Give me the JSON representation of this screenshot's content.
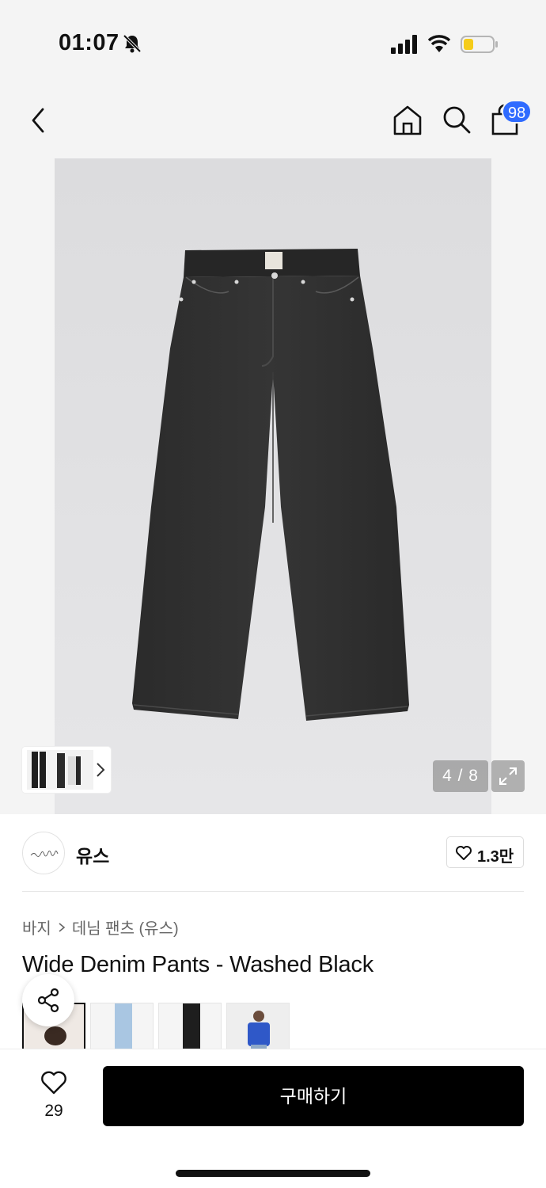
{
  "status_bar": {
    "time": "01:07"
  },
  "header": {
    "cart_badge": "98"
  },
  "gallery": {
    "page_indicator": "4 / 8"
  },
  "brand": {
    "name": "유스",
    "like_count": "1.3만"
  },
  "breadcrumb": {
    "category": "바지",
    "subcategory": "데님 팬츠 (유스)"
  },
  "product": {
    "title": "Wide Denim Pants - Washed Black"
  },
  "bottom_bar": {
    "wish_count": "29",
    "buy_label": "구매하기"
  },
  "colors": {
    "accent": "#2f6bff",
    "buy_button": "#000000"
  }
}
